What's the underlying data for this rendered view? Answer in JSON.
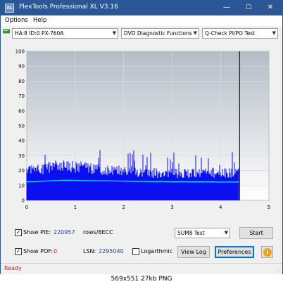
{
  "window": {
    "title": "PlexTools Professional XL V3.16",
    "app_icon_text": "XL",
    "minimize": "—",
    "maximize": "☐",
    "close": "✕"
  },
  "menu": {
    "items": [
      {
        "label": "Options"
      },
      {
        "label": "Help"
      }
    ]
  },
  "toolbar": {
    "drive": "HA:8 ID:0  PX-760A",
    "function": "DVD Diagnostic Functions",
    "test": "Q-Check PI/PO Test"
  },
  "chart_data": {
    "type": "area",
    "x_ticks": [
      "0",
      "1",
      "2",
      "3",
      "4",
      "5"
    ],
    "y_ticks": [
      "0",
      "10",
      "20",
      "30",
      "40",
      "50",
      "60",
      "70",
      "80",
      "90",
      "100"
    ],
    "xlim": [
      0,
      5
    ],
    "ylim": [
      0,
      100
    ],
    "grid": true,
    "end_marker_x": 4.38,
    "series": [
      {
        "kind": "PIE bars",
        "color": "#0a10f0",
        "x": [
          0,
          0.2,
          0.4,
          0.6,
          0.8,
          1.0,
          1.2,
          1.4,
          1.6,
          1.8,
          2.0,
          2.2,
          2.4,
          2.6,
          2.8,
          3.0,
          3.2,
          3.4,
          3.6,
          3.8,
          4.0,
          4.2,
          4.38
        ],
        "values": [
          22,
          22,
          24,
          25,
          25,
          24,
          24,
          23,
          22,
          22,
          21,
          21,
          20,
          20,
          20,
          20,
          19,
          20,
          20,
          20,
          20,
          20,
          23
        ]
      },
      {
        "kind": "PIE average",
        "color": "#00e0ff",
        "x": [
          0,
          0.2,
          0.4,
          0.6,
          0.8,
          1.0,
          1.2,
          1.4,
          1.6,
          1.8,
          2.0,
          2.2,
          2.4,
          2.6,
          2.8,
          3.0,
          3.2,
          3.4,
          3.6,
          3.8,
          4.0,
          4.2,
          4.38
        ],
        "values": [
          12.5,
          12.6,
          13.0,
          13.3,
          13.5,
          13.4,
          13.3,
          13.2,
          13.1,
          13.0,
          12.9,
          12.8,
          12.7,
          12.6,
          12.6,
          12.5,
          12.5,
          12.4,
          12.4,
          12.4,
          12.3,
          12.3,
          12.3
        ]
      }
    ]
  },
  "controls": {
    "show_pie_label": "Show PIE:",
    "pie_value": "220957",
    "pie_unit": "rows/8ECC",
    "show_pof_label": "Show POF:",
    "pof_value": "0",
    "lsn_label": "LSN:",
    "lsn_value": "2295040",
    "logarithmic_label": "Logarthmic",
    "sum_select": "SUM8 Test",
    "start_button": "Start",
    "view_log_button": "View Log",
    "preferences_button": "Preferences",
    "info_icon": "i",
    "check_mark": "✓"
  },
  "status": {
    "text": "Ready"
  },
  "caption": "569x551  27kb  PNG"
}
